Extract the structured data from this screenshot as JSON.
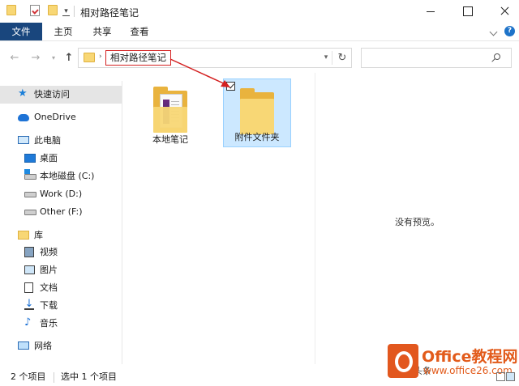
{
  "window": {
    "title": "相对路径笔记",
    "controls": [
      "minimize",
      "maximize",
      "close"
    ]
  },
  "ribbon": {
    "tabs": [
      {
        "label": "文件",
        "active": true
      },
      {
        "label": "主页"
      },
      {
        "label": "共享"
      },
      {
        "label": "查看"
      }
    ],
    "help_label": "?"
  },
  "address_bar": {
    "path_segment": "相对路径笔记",
    "breadcrumb_arrow": "›"
  },
  "search": {
    "placeholder": ""
  },
  "sidebar": {
    "quick_access": {
      "label": "快速访问",
      "icon": "star-icon",
      "selected": true
    },
    "onedrive": {
      "label": "OneDrive",
      "icon": "cloud-icon"
    },
    "this_pc": {
      "label": "此电脑",
      "icon": "computer-icon",
      "children": [
        {
          "label": "桌面",
          "icon": "desktop-icon"
        },
        {
          "label": "本地磁盘 (C:)",
          "icon": "windows-drive-icon"
        },
        {
          "label": "Work (D:)",
          "icon": "drive-icon"
        },
        {
          "label": "Other (F:)",
          "icon": "drive-icon"
        }
      ]
    },
    "libraries": {
      "label": "库",
      "icon": "library-icon",
      "children": [
        {
          "label": "视频",
          "icon": "video-icon"
        },
        {
          "label": "图片",
          "icon": "pictures-icon"
        },
        {
          "label": "文档",
          "icon": "documents-icon"
        },
        {
          "label": "下载",
          "icon": "download-icon"
        },
        {
          "label": "音乐",
          "icon": "music-icon"
        }
      ]
    },
    "network": {
      "label": "网络",
      "icon": "network-icon"
    }
  },
  "files": [
    {
      "name": "本地笔记",
      "icon": "folder-with-documents-icon",
      "selected": false
    },
    {
      "name": "附件文件夹",
      "icon": "folder-icon",
      "selected": true
    }
  ],
  "preview": {
    "text": "没有预览。"
  },
  "status": {
    "item_count": "2 个项目",
    "selected": "选中 1 个项目"
  },
  "annotation": {
    "color": "#d42020",
    "description_icon": "red-arrow"
  },
  "watermark": {
    "brand": "Office教程网",
    "site": "www.office26.com",
    "author": "头条"
  },
  "colors": {
    "file_tab": "#19467d",
    "selection": "#cce8ff",
    "selection_border": "#99d1ff",
    "folder": "#f8d775",
    "annotation_red": "#d42020",
    "watermark_orange": "#e25b1b"
  }
}
